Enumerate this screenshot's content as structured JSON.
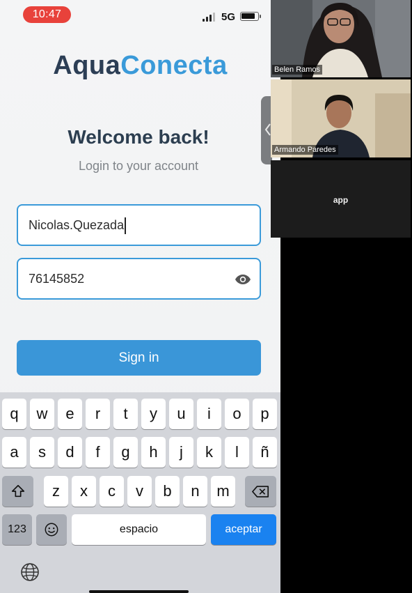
{
  "status_bar": {
    "time": "10:47",
    "network": "5G"
  },
  "brand": {
    "part1": "Aqua",
    "part2": "Conecta"
  },
  "login": {
    "heading": "Welcome back!",
    "subheading": "Login to your account",
    "username_value": "Nicolas.Quezada",
    "password_value": "76145852",
    "signin_label": "Sign in"
  },
  "keyboard": {
    "row1": [
      "q",
      "w",
      "e",
      "r",
      "t",
      "y",
      "u",
      "i",
      "o",
      "p"
    ],
    "row2": [
      "a",
      "s",
      "d",
      "f",
      "g",
      "h",
      "j",
      "k",
      "l",
      "ñ"
    ],
    "row3": [
      "z",
      "x",
      "c",
      "v",
      "b",
      "n",
      "m"
    ],
    "numbers_label": "123",
    "space_label": "espacio",
    "return_label": "aceptar"
  },
  "video_call": {
    "participants": [
      "Belen Ramos",
      "Armando Paredes"
    ],
    "screen_share_label": "app"
  },
  "colors": {
    "accent": "#3a9ad9",
    "brand_dark": "#2c3e55",
    "recording": "#e8423b",
    "keyboard_return": "#1a82f0"
  },
  "icons": [
    "eye-icon",
    "shift-icon",
    "backspace-icon",
    "emoji-icon",
    "globe-icon",
    "chevron-left-icon"
  ]
}
